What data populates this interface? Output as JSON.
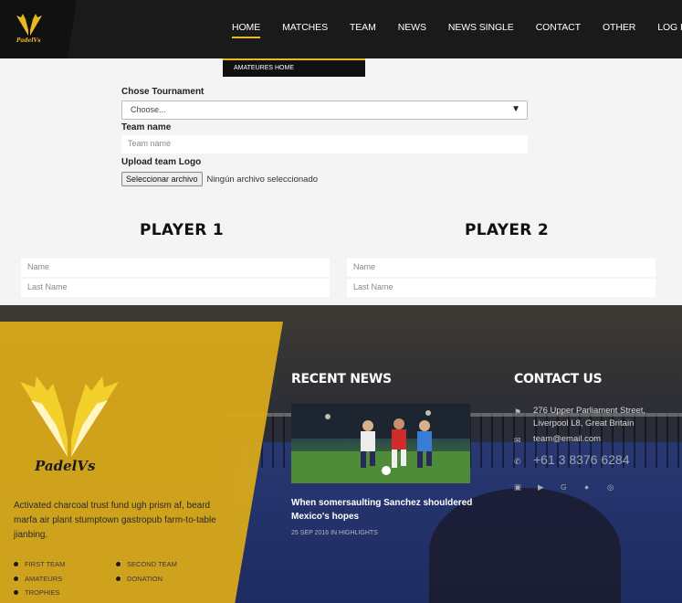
{
  "brand": {
    "name": "PadelVs",
    "accent": "#e8b923"
  },
  "nav": {
    "items": [
      "HOME",
      "MATCHES",
      "TEAM",
      "NEWS",
      "NEWS SINGLE",
      "CONTACT",
      "OTHER",
      "LOG IN"
    ],
    "active": "HOME",
    "submenu": [
      "AMATEURES HOME"
    ]
  },
  "form": {
    "tournament_label": "Chose Tournament",
    "tournament_value": "Choose...",
    "team_name_label": "Team name",
    "team_name_placeholder": "Team name",
    "logo_label": "Upload team Logo",
    "file_button": "Seleccionar archivo",
    "file_status": "Ningún archivo seleccionado"
  },
  "players": [
    {
      "title": "PLAYER 1",
      "name_placeholder": "Name",
      "last_placeholder": "Last Name"
    },
    {
      "title": "PLAYER 2",
      "name_placeholder": "Name",
      "last_placeholder": "Last Name"
    }
  ],
  "footer": {
    "about": "Activated charcoal trust fund ugh prism af, beard marfa air plant stumptown gastropub farm-to-table jianbing.",
    "links_col1": [
      "FIRST TEAM",
      "AMATEURS",
      "TROPHIES"
    ],
    "links_col2": [
      "SECOND TEAM",
      "DONATION"
    ],
    "recent_news_title": "RECENT NEWS",
    "news_headline": "When somersaulting Sanchez shouldered Mexico's hopes",
    "news_date": "25 SEP 2016",
    "news_in": "IN",
    "news_category": "HIGHLIGHTS",
    "contact_title": "CONTACT US",
    "address_line1": "276 Upper Parliament Street,",
    "address_line2": "Liverpool L8, Great Britain",
    "email": "team@email.com",
    "phone": "+61 3 8376 6284",
    "social_icons": [
      "facebook-icon",
      "twitter-icon",
      "google-icon",
      "pinterest-icon",
      "instagram-icon"
    ]
  }
}
